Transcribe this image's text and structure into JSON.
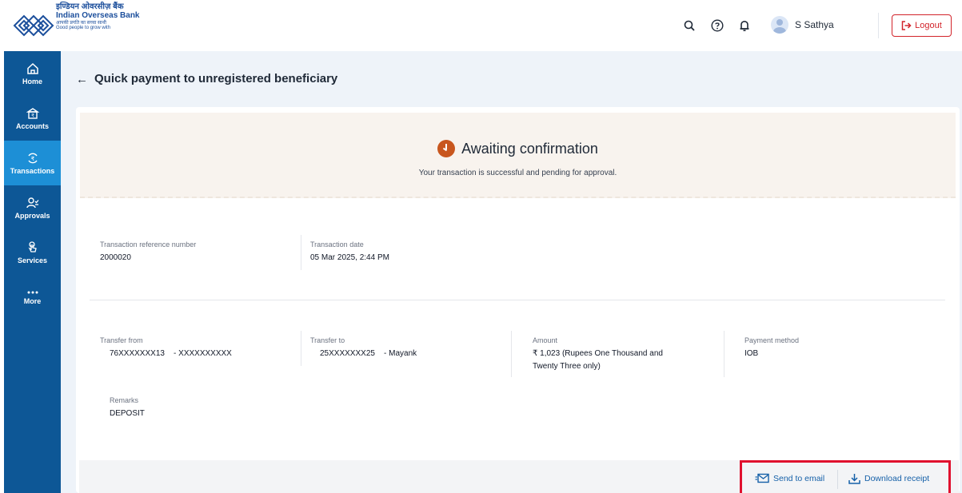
{
  "header": {
    "brand_hindi": "इण्डियन ओवरसीज़ बैंक",
    "brand_english": "Indian Overseas Bank",
    "tagline_hindi": "आपकी प्रगति का सच्चा साथी",
    "tagline_english": "Good people to grow with",
    "icons": [
      "search-icon",
      "help-icon",
      "bell-icon"
    ],
    "user_name": "S Sathya",
    "logout_label": "Logout"
  },
  "sidebar": {
    "items": [
      {
        "label": "Home",
        "icon": "home-icon",
        "active": false
      },
      {
        "label": "Accounts",
        "icon": "bank-icon",
        "active": false
      },
      {
        "label": "Transactions",
        "icon": "rupee-transfer-icon",
        "active": true
      },
      {
        "label": "Approvals",
        "icon": "approvals-icon",
        "active": false
      },
      {
        "label": "Services",
        "icon": "hand-tap-icon",
        "active": false
      },
      {
        "label": "More",
        "icon": "ellipsis-icon",
        "active": false
      }
    ]
  },
  "page": {
    "back_glyph": "←",
    "title": "Quick payment to unregistered beneficiary"
  },
  "status": {
    "title": "Awaiting confirmation",
    "subtitle": "Your transaction is successful and pending for approval.",
    "color": "#c8561e"
  },
  "details": {
    "ref_label": "Transaction reference number",
    "ref_value": "2000020",
    "date_label": "Transaction date",
    "date_value": "05 Mar 2025, 2:44 PM",
    "from_label": "Transfer from",
    "from_value": "76XXXXXXX13    - XXXXXXXXXX",
    "to_label": "Transfer to",
    "to_value": "25XXXXXXX25    - Mayank",
    "amount_label": "Amount",
    "amount_value_line1": "₹ 1,023 (Rupees One Thousand and",
    "amount_value_line2": "Twenty Three  only)",
    "method_label": "Payment method",
    "method_value": "IOB",
    "remarks_label": "Remarks",
    "remarks_value": "DEPOSIT"
  },
  "actions": {
    "email_label": "Send to email",
    "download_label": "Download receipt"
  },
  "colors": {
    "sidebar": "#0d5796",
    "sidebar_active": "#1d8fd6",
    "logout": "#d2232a",
    "link": "#1560a8",
    "highlight_box": "#e0102e"
  }
}
